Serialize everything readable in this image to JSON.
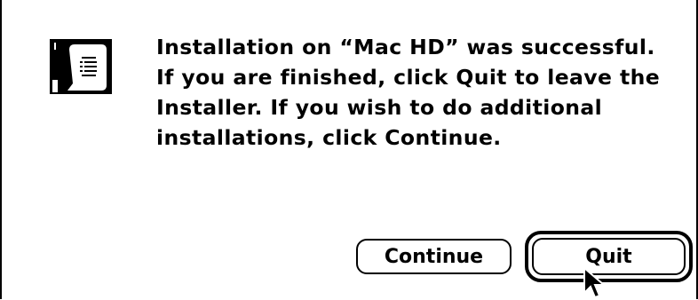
{
  "dialog": {
    "message_lines": [
      "Installation on “Mac HD” was successful.",
      "If you are finished, click Quit to leave the",
      "Installer.  If you wish to do additional",
      "installations, click Continue."
    ],
    "icon": "installer-document-icon"
  },
  "buttons": {
    "continue_label": "Continue",
    "quit_label": "Quit",
    "default_button": "quit"
  },
  "cursor": {
    "icon": "arrow-pointer-icon"
  }
}
